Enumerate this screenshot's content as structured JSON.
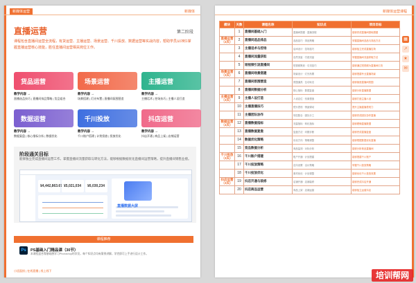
{
  "left": {
    "header_tag": "新媒体运营",
    "header_right": "新媒体",
    "title": "直播运营",
    "chapter": "第二阶段",
    "intro": "课程包含直播间运营全流程，有货运营、主播运营、场景运营、千川投放、数据运营等实战内容，帮助学员从0到1掌握直播运营核心技能，胜任直播间运营相关岗位工作。",
    "cards": [
      {
        "label": "货品运营",
        "color": "#ef4f6f",
        "sub_label": "教学内容 →",
        "sub_items": "直播选品技巧 | 直播间排品策略 | 货品组合"
      },
      {
        "label": "场景运营",
        "color": "#f26a4a",
        "sub_label": "教学内容 →",
        "sub_items": "场景搭建 | 灯光布置 | 直播间氛围营造"
      },
      {
        "label": "主播运营",
        "color": "#2fb48e",
        "sub_label": "教学内容 →",
        "sub_items": "主播话术 | 控场技巧 | 主播人设打造"
      },
      {
        "label": "数据运营",
        "color": "#7b5fd0",
        "sub_label": "教学内容 →",
        "sub_items": "数据复盘 | 核心指标分析 | 数据优化"
      },
      {
        "label": "千川投放",
        "color": "#3f6fe0",
        "sub_label": "教学内容 →",
        "sub_items": "千川账户搭建 | 计划投放 | 投放优化"
      },
      {
        "label": "抖店运营",
        "color": "#f06a8a",
        "sub_label": "教学内容 →",
        "sub_items": "抖店开通 | 商品上架 | 店铺运营"
      }
    ],
    "path_title": "阶段通关目标",
    "path_desc": "能够独立完成直播间运营工作，掌握直播间流量获取与转化方法，能够根据数据优化直播间运营策略，提升直播间销售业绩。",
    "screenshot": {
      "stats": [
        "¥4,442,863.67",
        "¥5,021,034",
        "¥6,030,234",
        "¥4,442,863.67"
      ],
      "highlight": "直播数据大屏"
    },
    "recommend_bar": "课程推荐",
    "ps_icon": "Ps",
    "ps_title": "PS基础入门精品课（30节）",
    "ps_desc": "本课程适合零基础想学习Photoshop的学员，每个知识点均有案例讲解，学完即可上手进行设计工作。",
    "footer": "小班面授 | 在线直播 | 线上线下"
  },
  "right": {
    "header_right": "新媒体运营课程",
    "columns": [
      "模块",
      "天数",
      "课程名称",
      "知识点",
      "项目目标"
    ],
    "rows": [
      {
        "module": "",
        "day": "1",
        "name": "直播间基础入门",
        "point": "直播间搭建 · 直播流程",
        "goal": "能够完成直播间基础搭建"
      },
      {
        "module": "直播运营（4天）",
        "day": "2",
        "name": "直播间选品排品",
        "point": "选品技巧 · 排品策略",
        "goal": "掌握直播间选品与排品方法"
      },
      {
        "module": "",
        "day": "3",
        "name": "主播话术与控场",
        "point": "话术设计 · 控场技巧",
        "goal": "能够独立完成直播控场"
      },
      {
        "module": "",
        "day": "4",
        "name": "直播间流量获取",
        "point": "自然流量 · 付费流量",
        "goal": "掌握直播间流量获取方法"
      },
      {
        "module": "",
        "day": "5",
        "name": "短视频引流直播间",
        "point": "短视频策划 · 引流技巧",
        "goal": "能够通过短视频为直播间引流"
      },
      {
        "module": "场景运营（3天）",
        "day": "6",
        "name": "直播间场景搭建",
        "point": "场景设计 · 灯光布置",
        "goal": "能够搭建专业直播场景"
      },
      {
        "module": "",
        "day": "7",
        "name": "直播间氛围营造",
        "point": "氛围道具 · 互动玩法",
        "goal": "能够营造直播间氛围"
      },
      {
        "module": "",
        "day": "8",
        "name": "直播间数据分析",
        "point": "核心指标 · 数据复盘",
        "goal": "能够分析直播数据"
      },
      {
        "module": "主播运营（3天）",
        "day": "9",
        "name": "主播人设打造",
        "point": "人设定位 · 形象塑造",
        "goal": "能够打造主播人设"
      },
      {
        "module": "",
        "day": "10",
        "name": "主播直播技巧",
        "point": "镜头表现 · 情绪调动",
        "goal": "提升主播直播表现力"
      },
      {
        "module": "",
        "day": "11",
        "name": "主播团队协作",
        "point": "场控配合 · 团队分工",
        "goal": "能够完成团队协作直播"
      },
      {
        "module": "数据运营（4天）",
        "day": "12",
        "name": "直播数据指标",
        "point": "流量指标 · 转化指标",
        "goal": "能够看懂直播数据"
      },
      {
        "module": "",
        "day": "13",
        "name": "直播数据复盘",
        "point": "复盘方法 · 问题诊断",
        "goal": "能够完成直播复盘"
      },
      {
        "module": "",
        "day": "14",
        "name": "数据优化策略",
        "point": "优化方向 · 策略调整",
        "goal": "能够根据数据优化直播"
      },
      {
        "module": "",
        "day": "15",
        "name": "竞品数据分析",
        "point": "竞品监测 · 对标分析",
        "goal": "能够分析竞品直播间"
      },
      {
        "module": "千川投放（3天）",
        "day": "16",
        "name": "千川账户搭建",
        "point": "账户开通 · 计划搭建",
        "goal": "能够搭建千川账户"
      },
      {
        "module": "",
        "day": "17",
        "name": "千川投放策略",
        "point": "定向设置 · 出价策略",
        "goal": "掌握千川投放策略"
      },
      {
        "module": "",
        "day": "18",
        "name": "千川投放优化",
        "point": "素材优化 · 计划调整",
        "goal": "能够优化千川投放效果"
      },
      {
        "module": "抖店运营（3天）",
        "day": "19",
        "name": "抖店开通与装修",
        "point": "店铺开通 · 店铺装修",
        "goal": "能够完成抖店开通"
      },
      {
        "module": "",
        "day": "20",
        "name": "抖店商品运营",
        "point": "商品上架 · 店铺运营",
        "goal": "能够独立运营抖店"
      }
    ],
    "side_icons": [
      "grid-icon",
      "share-icon",
      "star-icon",
      "chat-icon"
    ],
    "watermark": "培训帮网"
  }
}
